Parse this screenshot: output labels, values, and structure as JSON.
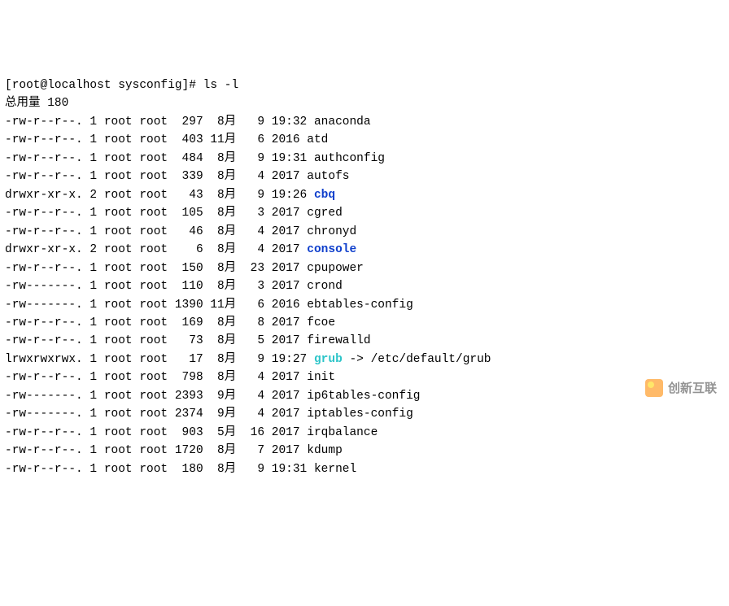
{
  "prompt": "[root@localhost sysconfig]# ls -l",
  "total_line": "总用量 180",
  "rows": [
    {
      "perm": "-rw-r--r--.",
      "links": "1",
      "owner": "root",
      "group": "root",
      "size": "297",
      "month": "8月",
      "day": "9",
      "time": "19:32",
      "name": "anaconda",
      "type": "file",
      "tail": ""
    },
    {
      "perm": "-rw-r--r--.",
      "links": "1",
      "owner": "root",
      "group": "root",
      "size": "403",
      "month": "11月",
      "day": "6",
      "time": "2016",
      "name": "atd",
      "type": "file",
      "tail": ""
    },
    {
      "perm": "-rw-r--r--.",
      "links": "1",
      "owner": "root",
      "group": "root",
      "size": "484",
      "month": "8月",
      "day": "9",
      "time": "19:31",
      "name": "authconfig",
      "type": "file",
      "tail": ""
    },
    {
      "perm": "-rw-r--r--.",
      "links": "1",
      "owner": "root",
      "group": "root",
      "size": "339",
      "month": "8月",
      "day": "4",
      "time": "2017",
      "name": "autofs",
      "type": "file",
      "tail": ""
    },
    {
      "perm": "drwxr-xr-x.",
      "links": "2",
      "owner": "root",
      "group": "root",
      "size": "43",
      "month": "8月",
      "day": "9",
      "time": "19:26",
      "name": "cbq",
      "type": "dir",
      "tail": ""
    },
    {
      "perm": "-rw-r--r--.",
      "links": "1",
      "owner": "root",
      "group": "root",
      "size": "105",
      "month": "8月",
      "day": "3",
      "time": "2017",
      "name": "cgred",
      "type": "file",
      "tail": ""
    },
    {
      "perm": "-rw-r--r--.",
      "links": "1",
      "owner": "root",
      "group": "root",
      "size": "46",
      "month": "8月",
      "day": "4",
      "time": "2017",
      "name": "chronyd",
      "type": "file",
      "tail": ""
    },
    {
      "perm": "drwxr-xr-x.",
      "links": "2",
      "owner": "root",
      "group": "root",
      "size": "6",
      "month": "8月",
      "day": "4",
      "time": "2017",
      "name": "console",
      "type": "dir",
      "tail": ""
    },
    {
      "perm": "-rw-r--r--.",
      "links": "1",
      "owner": "root",
      "group": "root",
      "size": "150",
      "month": "8月",
      "day": "23",
      "time": "2017",
      "name": "cpupower",
      "type": "file",
      "tail": ""
    },
    {
      "perm": "-rw-------.",
      "links": "1",
      "owner": "root",
      "group": "root",
      "size": "110",
      "month": "8月",
      "day": "3",
      "time": "2017",
      "name": "crond",
      "type": "file",
      "tail": ""
    },
    {
      "perm": "-rw-------.",
      "links": "1",
      "owner": "root",
      "group": "root",
      "size": "1390",
      "month": "11月",
      "day": "6",
      "time": "2016",
      "name": "ebtables-config",
      "type": "file",
      "tail": ""
    },
    {
      "perm": "-rw-r--r--.",
      "links": "1",
      "owner": "root",
      "group": "root",
      "size": "169",
      "month": "8月",
      "day": "8",
      "time": "2017",
      "name": "fcoe",
      "type": "file",
      "tail": ""
    },
    {
      "perm": "-rw-r--r--.",
      "links": "1",
      "owner": "root",
      "group": "root",
      "size": "73",
      "month": "8月",
      "day": "5",
      "time": "2017",
      "name": "firewalld",
      "type": "file",
      "tail": ""
    },
    {
      "perm": "lrwxrwxrwx.",
      "links": "1",
      "owner": "root",
      "group": "root",
      "size": "17",
      "month": "8月",
      "day": "9",
      "time": "19:27",
      "name": "grub",
      "type": "link",
      "tail": " -> /etc/default/grub"
    },
    {
      "perm": "-rw-r--r--.",
      "links": "1",
      "owner": "root",
      "group": "root",
      "size": "798",
      "month": "8月",
      "day": "4",
      "time": "2017",
      "name": "init",
      "type": "file",
      "tail": ""
    },
    {
      "perm": "-rw-------.",
      "links": "1",
      "owner": "root",
      "group": "root",
      "size": "2393",
      "month": "9月",
      "day": "4",
      "time": "2017",
      "name": "ip6tables-config",
      "type": "file",
      "tail": ""
    },
    {
      "perm": "-rw-------.",
      "links": "1",
      "owner": "root",
      "group": "root",
      "size": "2374",
      "month": "9月",
      "day": "4",
      "time": "2017",
      "name": "iptables-config",
      "type": "file",
      "tail": ""
    },
    {
      "perm": "-rw-r--r--.",
      "links": "1",
      "owner": "root",
      "group": "root",
      "size": "903",
      "month": "5月",
      "day": "16",
      "time": "2017",
      "name": "irqbalance",
      "type": "file",
      "tail": ""
    },
    {
      "perm": "-rw-r--r--.",
      "links": "1",
      "owner": "root",
      "group": "root",
      "size": "1720",
      "month": "8月",
      "day": "7",
      "time": "2017",
      "name": "kdump",
      "type": "file",
      "tail": ""
    },
    {
      "perm": "-rw-r--r--.",
      "links": "1",
      "owner": "root",
      "group": "root",
      "size": "180",
      "month": "8月",
      "day": "9",
      "time": "19:31",
      "name": "kernel",
      "type": "file",
      "tail": ""
    }
  ],
  "watermark": "创新互联"
}
